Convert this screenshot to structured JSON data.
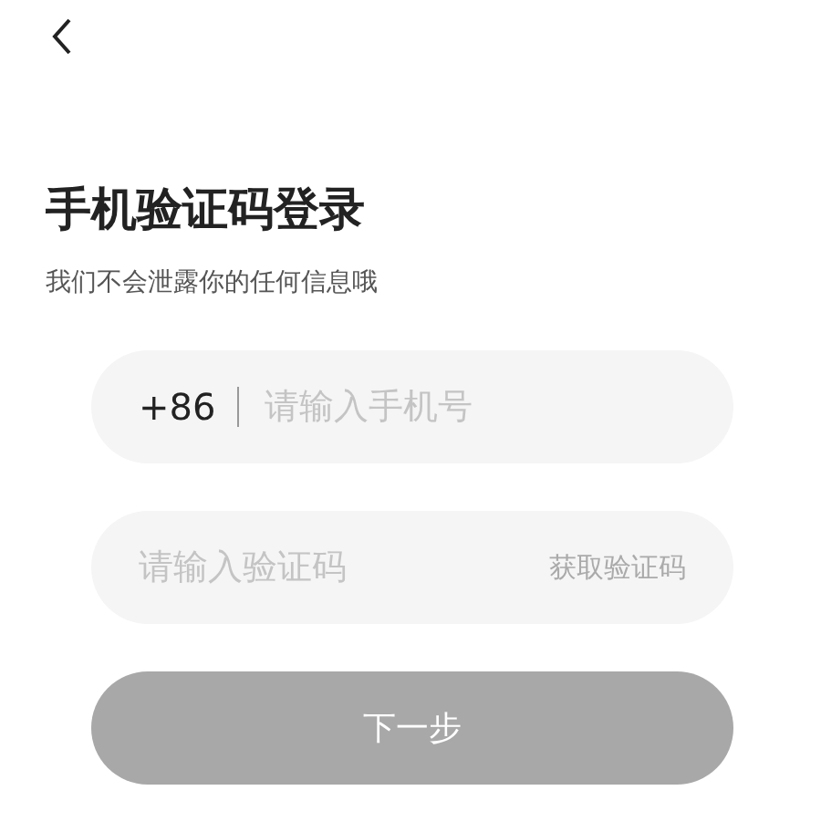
{
  "title": "手机验证码登录",
  "subtitle": "我们不会泄露你的任何信息哦",
  "phone": {
    "prefix": "+86",
    "placeholder": "请输入手机号"
  },
  "code": {
    "placeholder": "请输入验证码",
    "action": "获取验证码"
  },
  "next_button": {
    "label": "下一步",
    "disabled": true
  }
}
